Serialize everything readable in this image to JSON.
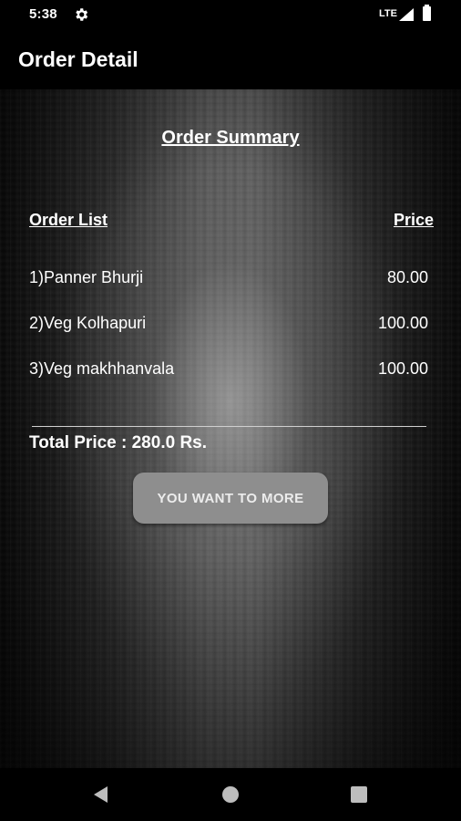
{
  "status_bar": {
    "time": "5:38",
    "network": "LTE",
    "icons": [
      "gear-icon",
      "signal-icon",
      "battery-icon"
    ]
  },
  "toolbar": {
    "title": "Order Detail"
  },
  "summary": {
    "title": "Order Summary",
    "list_header": "Order List",
    "price_header": "Price",
    "items": [
      {
        "name": "1)Panner Bhurji",
        "price": "80.00"
      },
      {
        "name": "2)Veg Kolhapuri",
        "price": "100.00"
      },
      {
        "name": "3)Veg makhhanvala",
        "price": "100.00"
      }
    ],
    "total": "Total Price : 280.0 Rs."
  },
  "actions": {
    "more_label": "YOU WANT TO MORE"
  },
  "nav_bar": {
    "icons": [
      "back-icon",
      "home-icon",
      "recents-icon"
    ]
  },
  "colors": {
    "button_bg": "#8e8e8e",
    "text": "#ffffff",
    "bars": "#000000"
  }
}
